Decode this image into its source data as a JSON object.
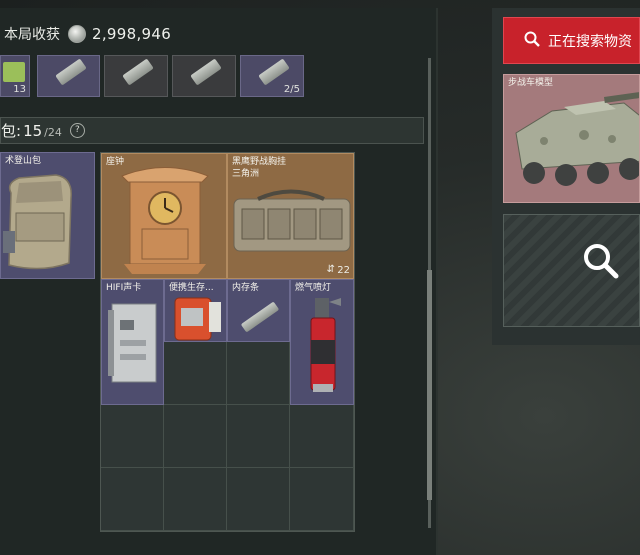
{
  "header": {
    "loot_label": "本局收获",
    "loot_value": "2,998,946",
    "coin_icon": "silver-coin-icon"
  },
  "quick_slots": [
    {
      "count": "13"
    },
    {
      "count": ""
    },
    {
      "count": ""
    },
    {
      "count": ""
    },
    {
      "count": "2/5"
    }
  ],
  "backpack": {
    "label": "包:",
    "current": "15",
    "total": "/24",
    "help": "?",
    "bag_name": "术登山包"
  },
  "grid_items": [
    {
      "name": "座钟",
      "color": "orange"
    },
    {
      "name": "黑鹰野战胸挂\n三角洲",
      "color": "orange",
      "count": "22",
      "count_icon": "stack-icon"
    },
    {
      "name": "HIFI声卡",
      "color": "purple"
    },
    {
      "name": "便携生存...",
      "color": "purple"
    },
    {
      "name": "内存条",
      "color": "purple"
    },
    {
      "name": "燃气喷灯",
      "color": "purple"
    }
  ],
  "search_panel": {
    "status": "正在搜索物资",
    "vehicle_name": "步战车模型",
    "search_icon": "magnifier-icon"
  },
  "colors": {
    "orange_rarity": "#8e6a44",
    "purple_rarity": "#4e4d6e",
    "red_rarity": "#a47a7c",
    "search_red": "#c8222b"
  }
}
